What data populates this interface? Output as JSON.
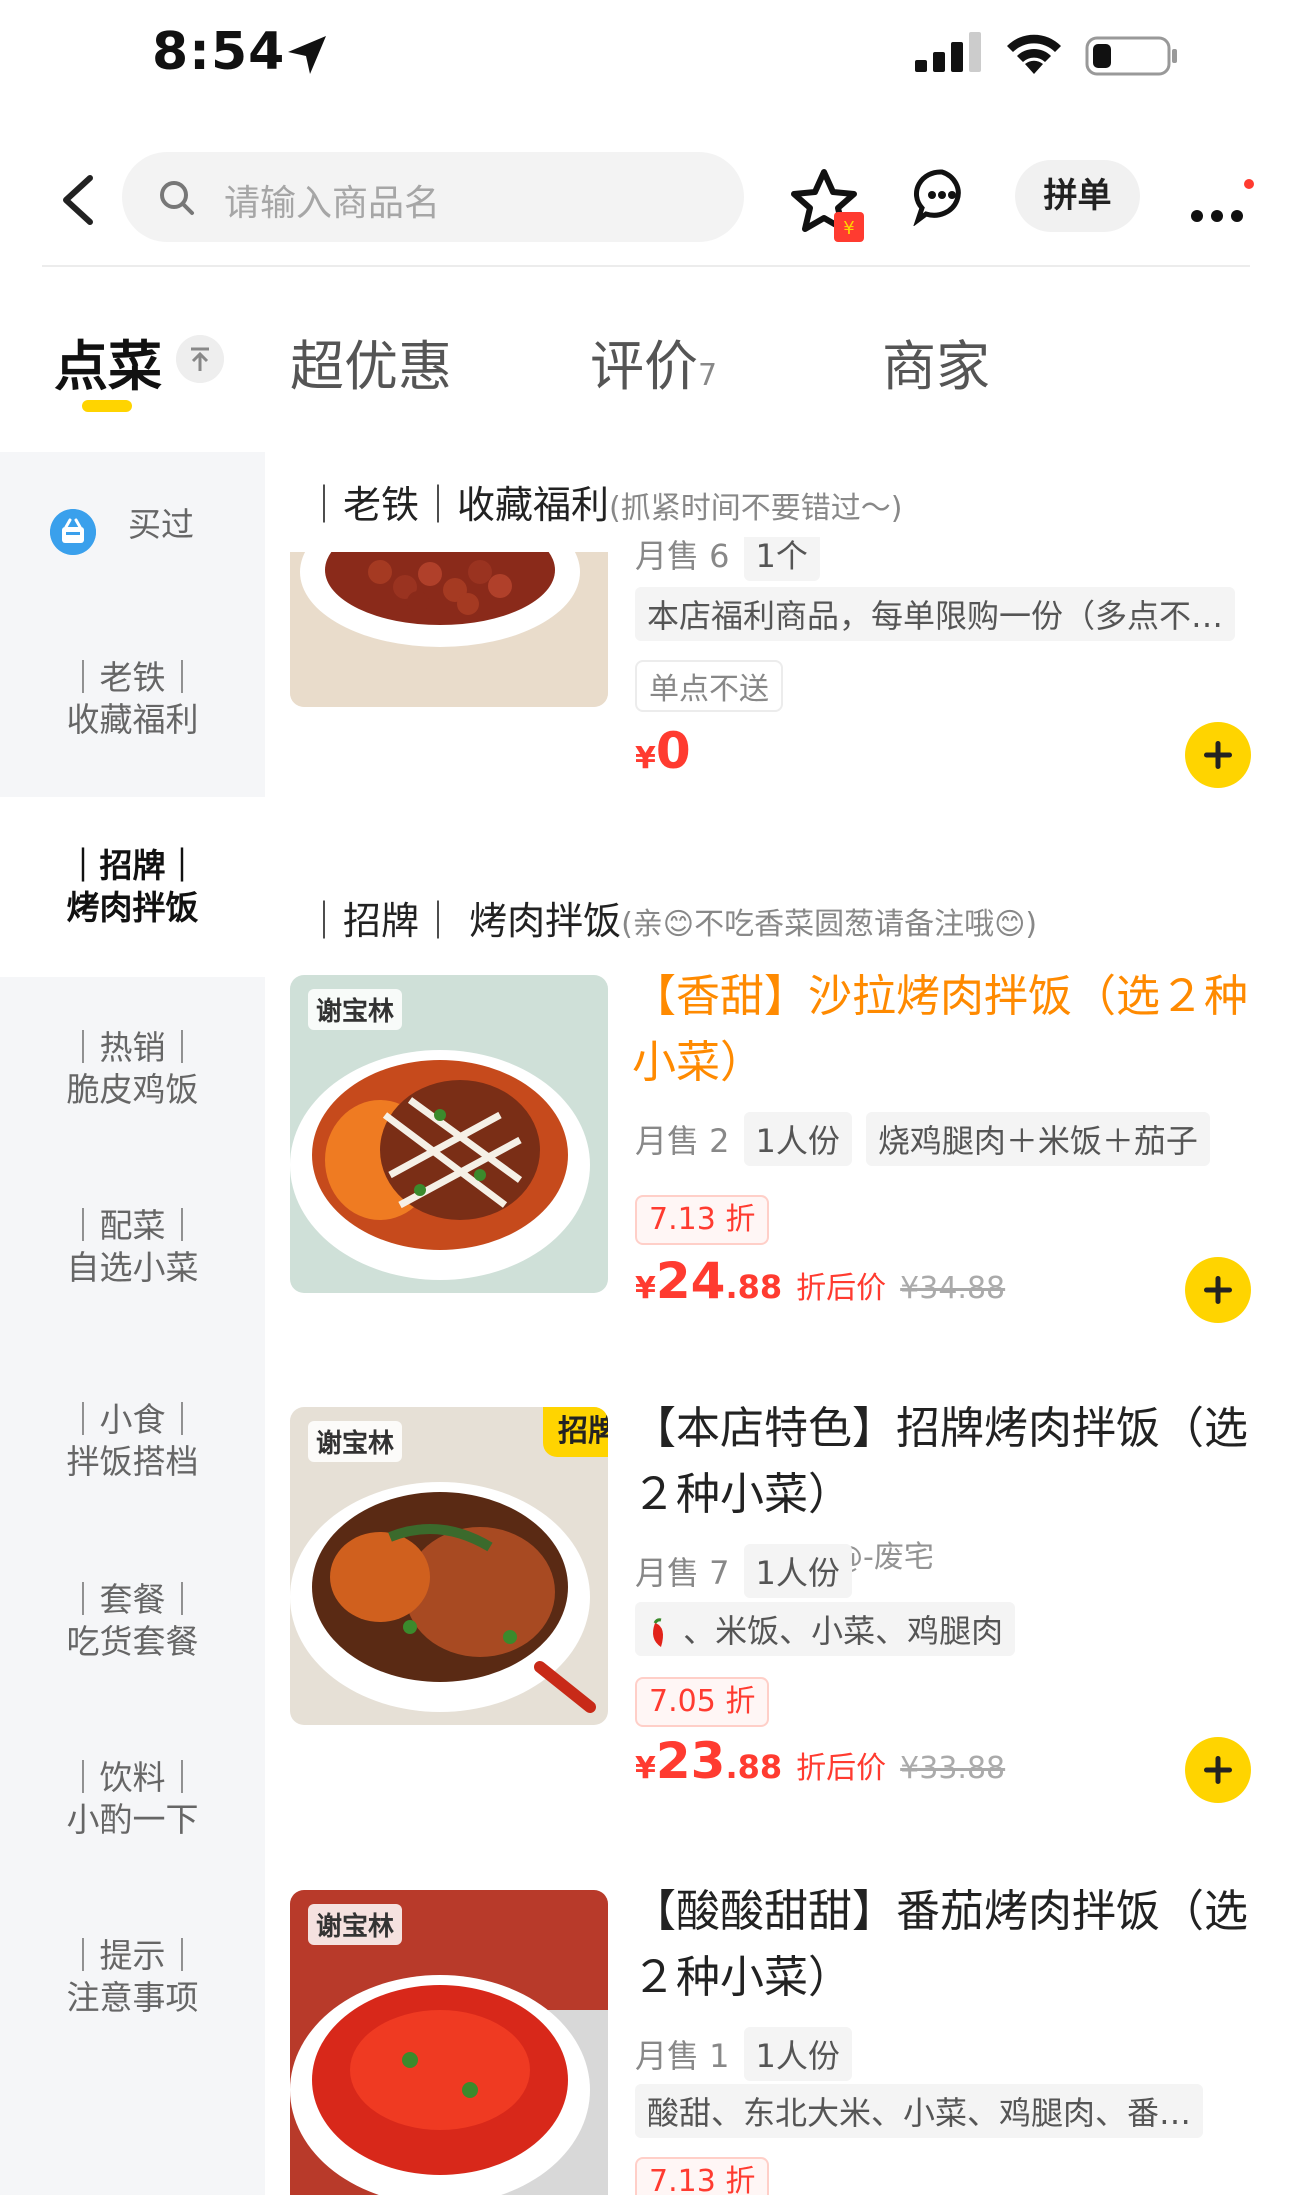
{
  "status_bar": {
    "time": "8:54"
  },
  "header": {
    "search_placeholder": "请输入商品名",
    "pin_label": "拼单"
  },
  "tabs": [
    {
      "label": "点菜"
    },
    {
      "label": "超优惠"
    },
    {
      "label": "评价",
      "count": "7"
    },
    {
      "label": "商家"
    }
  ],
  "sidebar": {
    "bought": "买过",
    "items": [
      {
        "line1": "｜老铁｜",
        "line2": "收藏福利"
      },
      {
        "line1": "｜招牌｜",
        "line2": "烤肉拌饭"
      },
      {
        "line1": "｜热销｜",
        "line2": "脆皮鸡饭"
      },
      {
        "line1": "｜配菜｜",
        "line2": "自选小菜"
      },
      {
        "line1": "｜小食｜",
        "line2": "拌饭搭档"
      },
      {
        "line1": "｜套餐｜",
        "line2": "吃货套餐"
      },
      {
        "line1": "｜饮料｜",
        "line2": "小酌一下"
      },
      {
        "line1": "｜提示｜",
        "line2": "注意事项"
      }
    ]
  },
  "sections": {
    "fav": {
      "title": "｜老铁｜收藏福利",
      "note": "(抓紧时间不要错过～)"
    },
    "signature": {
      "title": "｜招牌｜ 烤肉拌饭",
      "note": "(亲😊不吃香菜圆葱请备注哦😊)"
    }
  },
  "fav_item": {
    "sales": "月售 6",
    "portion": "1个",
    "desc": "本店福利商品，每单限购一份（多点不…",
    "tag": "单点不送",
    "price_yen": "¥",
    "price": "0"
  },
  "dishes": [
    {
      "name": "【香甜】沙拉烤肉拌饭（选２种小菜）",
      "brand": "谢宝林",
      "sales": "月售 2",
      "portion": "1人份",
      "desc": "烧鸡腿肉＋米饭＋茄子",
      "discount": "7.13 折",
      "price_yen": "¥",
      "price_int": "24",
      "price_dec": ".88",
      "after_label": "折后价",
      "orig_price": "¥34.88"
    },
    {
      "name": "【本店特色】招牌烤肉拌饭（选２种小菜）",
      "brand": "谢宝林",
      "badge": "招牌",
      "sales": "月售 7",
      "portion": "1人份",
      "desc": "、米饭、小菜、鸡腿肉",
      "discount": "7.05 折",
      "price_yen": "¥",
      "price_int": "23",
      "price_dec": ".88",
      "after_label": "折后价",
      "orig_price": "¥33.88"
    },
    {
      "name": "【酸酸甜甜】番茄烤肉拌饭（选２种小菜）",
      "brand": "谢宝林",
      "sales": "月售 1",
      "portion": "1人份",
      "desc": "酸甜、东北大米、小菜、鸡腿肉、番…",
      "discount": "7.13 折"
    }
  ],
  "watermark": "@-废宅",
  "colors": {
    "accent": "#ffd400",
    "price": "#ff3b30",
    "highlight_name": "#ff8a00",
    "sidebar_bg": "#f5f6f8"
  }
}
